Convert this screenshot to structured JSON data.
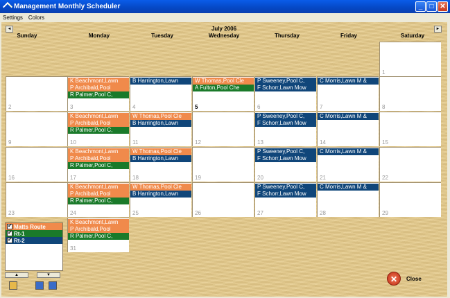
{
  "window": {
    "title": "Management Monthly Scheduler"
  },
  "menu": [
    "Settings",
    "Colors"
  ],
  "calendar": {
    "month_label": "July 2006",
    "prev_label": "◄",
    "next_label": "►",
    "weekdays": [
      "Sunday",
      "Monday",
      "Tuesday",
      "Wednesday",
      "Thursday",
      "Friday",
      "Saturday"
    ],
    "weeks": [
      [
        null,
        null,
        null,
        null,
        null,
        null,
        {
          "day": "1",
          "events": []
        }
      ],
      [
        {
          "day": "2",
          "events": []
        },
        {
          "day": "3",
          "events": [
            {
              "text": "K Beachmont,Lawn",
              "color": "orange"
            },
            {
              "text": "P Archibald,Pool",
              "color": "orange"
            },
            {
              "text": "R Palmer,Pool C,",
              "color": "green"
            }
          ]
        },
        {
          "day": "4",
          "events": [
            {
              "text": "B Harrington,Lawn",
              "color": "navy"
            }
          ]
        },
        {
          "day": "5",
          "today": true,
          "events": [
            {
              "text": "W Thomas,Pool Cle",
              "color": "orange"
            },
            {
              "text": "A Fulton,Pool Che",
              "color": "green"
            }
          ]
        },
        {
          "day": "6",
          "events": [
            {
              "text": "P Sweeney,Pool C,",
              "color": "navy"
            },
            {
              "text": "F Schorr,Lawn Mow",
              "color": "navy"
            }
          ]
        },
        {
          "day": "7",
          "events": [
            {
              "text": "C Morris,Lawn M &",
              "color": "navy"
            }
          ]
        },
        {
          "day": "8",
          "events": []
        }
      ],
      [
        {
          "day": "9",
          "events": []
        },
        {
          "day": "10",
          "events": [
            {
              "text": "K Beachmont,Lawn",
              "color": "orange"
            },
            {
              "text": "P Archibald,Pool",
              "color": "orange"
            },
            {
              "text": "R Palmer,Pool C,",
              "color": "green"
            }
          ]
        },
        {
          "day": "11",
          "events": [
            {
              "text": "W Thomas,Pool Cle",
              "color": "orange"
            },
            {
              "text": "B Harrington,Lawn",
              "color": "navy"
            }
          ]
        },
        {
          "day": "12",
          "events": []
        },
        {
          "day": "13",
          "events": [
            {
              "text": "P Sweeney,Pool C,",
              "color": "navy"
            },
            {
              "text": "F Schorr,Lawn Mow",
              "color": "navy"
            }
          ]
        },
        {
          "day": "14",
          "events": [
            {
              "text": "C Morris,Lawn M &",
              "color": "navy"
            }
          ]
        },
        {
          "day": "15",
          "events": []
        }
      ],
      [
        {
          "day": "16",
          "events": []
        },
        {
          "day": "17",
          "events": [
            {
              "text": "K Beachmont,Lawn",
              "color": "orange"
            },
            {
              "text": "P Archibald,Pool",
              "color": "orange"
            },
            {
              "text": "R Palmer,Pool C,",
              "color": "green"
            }
          ]
        },
        {
          "day": "18",
          "events": [
            {
              "text": "W Thomas,Pool Cle",
              "color": "orange"
            },
            {
              "text": "B Harrington,Lawn",
              "color": "navy"
            }
          ]
        },
        {
          "day": "19",
          "events": []
        },
        {
          "day": "20",
          "events": [
            {
              "text": "P Sweeney,Pool C,",
              "color": "navy"
            },
            {
              "text": "F Schorr,Lawn Mow",
              "color": "navy"
            }
          ]
        },
        {
          "day": "21",
          "events": [
            {
              "text": "C Morris,Lawn M &",
              "color": "navy"
            }
          ]
        },
        {
          "day": "22",
          "events": []
        }
      ],
      [
        {
          "day": "23",
          "events": []
        },
        {
          "day": "24",
          "events": [
            {
              "text": "K Beachmont,Lawn",
              "color": "orange"
            },
            {
              "text": "P Archibald,Pool",
              "color": "orange"
            },
            {
              "text": "R Palmer,Pool C,",
              "color": "green"
            }
          ]
        },
        {
          "day": "25",
          "events": [
            {
              "text": "W Thomas,Pool Cle",
              "color": "orange"
            },
            {
              "text": "B Harrington,Lawn",
              "color": "navy"
            }
          ]
        },
        {
          "day": "26",
          "events": []
        },
        {
          "day": "27",
          "events": [
            {
              "text": "P Sweeney,Pool C,",
              "color": "navy"
            },
            {
              "text": "F Schorr,Lawn Mow",
              "color": "navy"
            }
          ]
        },
        {
          "day": "28",
          "events": [
            {
              "text": "C Morris,Lawn M &",
              "color": "navy"
            }
          ]
        },
        {
          "day": "29",
          "events": []
        }
      ],
      [
        null,
        {
          "day": "31",
          "events": [
            {
              "text": "K Beachmont,Lawn",
              "color": "orange"
            },
            {
              "text": "P Archibald,Pool",
              "color": "orange"
            },
            {
              "text": "R Palmer,Pool C,",
              "color": "green"
            }
          ]
        },
        null,
        null,
        null,
        null,
        null
      ]
    ]
  },
  "routes": [
    {
      "label": "Matts Route",
      "color": "orange",
      "checked": true
    },
    {
      "label": "Rt-1",
      "color": "green",
      "checked": true
    },
    {
      "label": "Rt-2",
      "color": "navy",
      "checked": true
    }
  ],
  "colors": {
    "orange": "#f08a4b",
    "green": "#1a7a2a",
    "navy": "#10467a"
  },
  "close_label": "Close"
}
